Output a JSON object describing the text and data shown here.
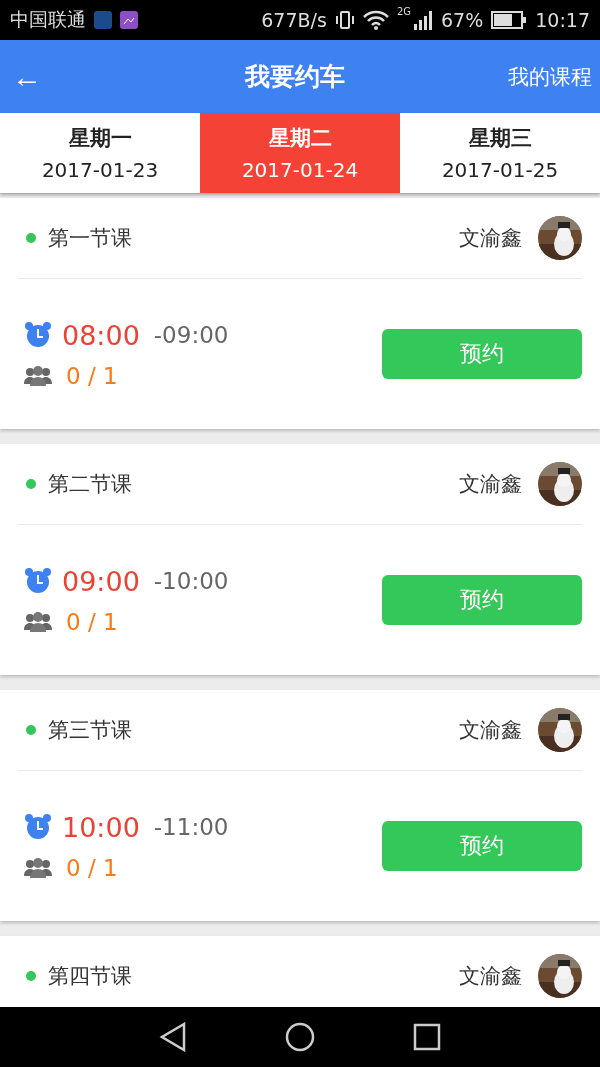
{
  "status_bar": {
    "carrier": "中国联通",
    "speed": "677B/s",
    "network": "2G",
    "battery": "67%",
    "time": "10:17"
  },
  "header": {
    "back": "←",
    "title": "我要约车",
    "action": "我的课程"
  },
  "day_tabs": [
    {
      "weekday": "星期一",
      "date": "2017-01-23",
      "selected": false
    },
    {
      "weekday": "星期二",
      "date": "2017-01-24",
      "selected": true
    },
    {
      "weekday": "星期三",
      "date": "2017-01-25",
      "selected": false
    }
  ],
  "lessons": [
    {
      "title": "第一节课",
      "teacher": "文渝鑫",
      "start": "08:00",
      "end": "-09:00",
      "count": "0 / 1",
      "button": "预约"
    },
    {
      "title": "第二节课",
      "teacher": "文渝鑫",
      "start": "09:00",
      "end": "-10:00",
      "count": "0 / 1",
      "button": "预约"
    },
    {
      "title": "第三节课",
      "teacher": "文渝鑫",
      "start": "10:00",
      "end": "-11:00",
      "count": "0 / 1",
      "button": "预约"
    },
    {
      "title": "第四节课",
      "teacher": "文渝鑫"
    }
  ]
}
